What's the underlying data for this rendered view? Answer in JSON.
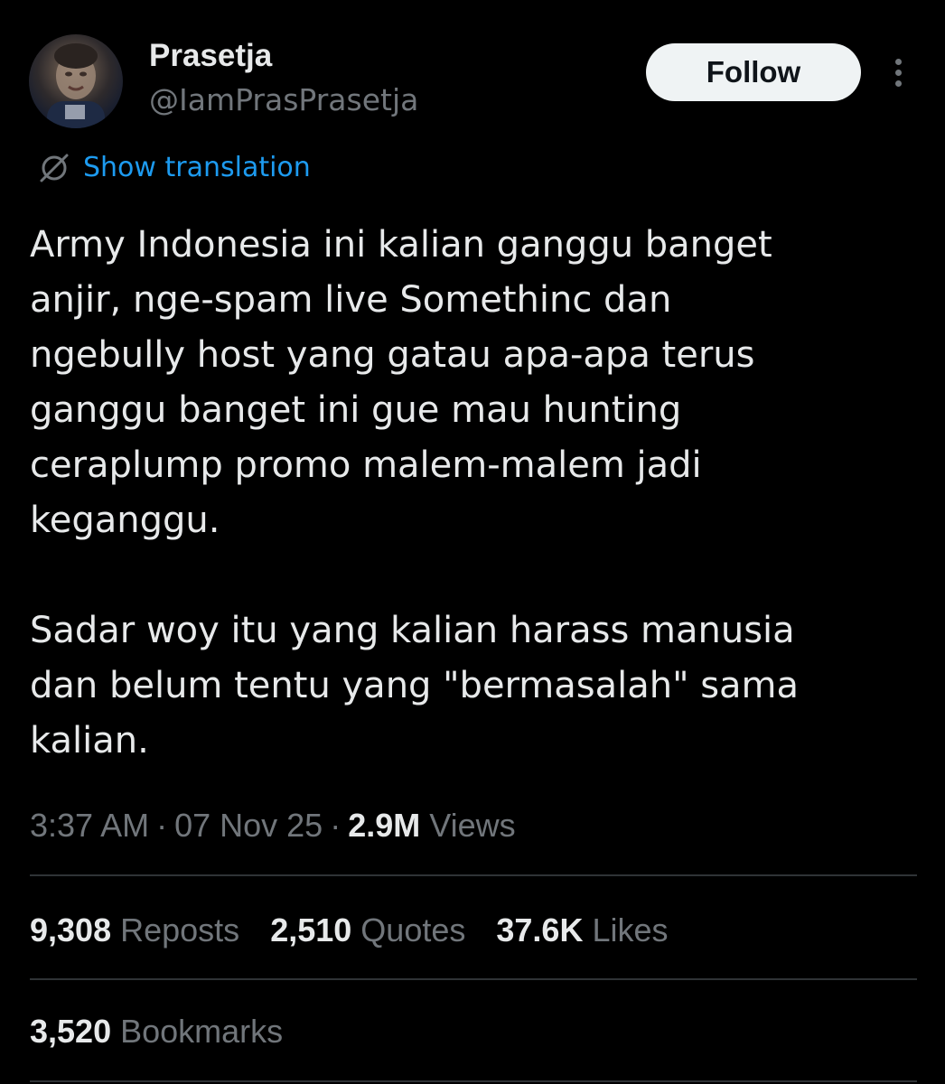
{
  "user": {
    "display_name": "Prasetja",
    "handle": "@IamPrasPrasetja"
  },
  "header": {
    "follow_label": "Follow",
    "more_icon": "more-vertical-icon"
  },
  "translation": {
    "icon": "globe-slash-icon",
    "label": "Show translation"
  },
  "tweet": {
    "paragraphs": [
      "Army Indonesia ini kalian ganggu banget\nanjir, nge-spam live Somethinc dan\nngebully host yang gatau apa-apa terus\nganggu banget ini gue mau hunting\nceraplump promo malem-malem jadi\nkeganggu.",
      "Sadar woy itu yang kalian harass manusia\ndan belum tentu yang \"bermasalah\" sama\nkalian."
    ]
  },
  "meta": {
    "time": "3:37 AM",
    "date": "07 Nov 25",
    "views_count": "2.9M",
    "views_label": "Views",
    "separator": "·"
  },
  "stats": {
    "reposts_count": "9,308",
    "reposts_label": "Reposts",
    "quotes_count": "2,510",
    "quotes_label": "Quotes",
    "likes_count": "37.6K",
    "likes_label": "Likes",
    "bookmarks_count": "3,520",
    "bookmarks_label": "Bookmarks"
  },
  "colors": {
    "background": "#000000",
    "text_primary": "#e7e9ea",
    "text_secondary": "#71767b",
    "link_blue": "#1d9bf0",
    "divider": "#2f3336",
    "follow_button_bg": "#eff3f4"
  }
}
